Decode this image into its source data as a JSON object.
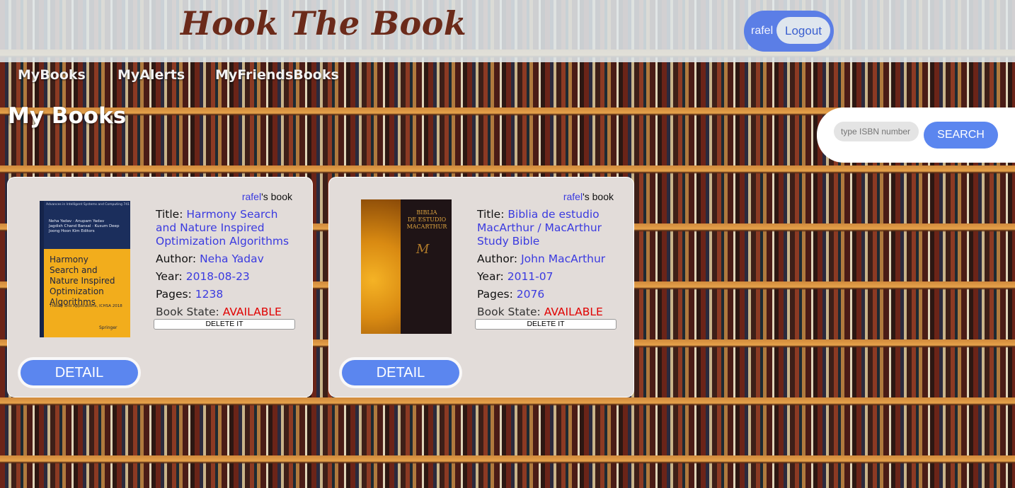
{
  "site": {
    "title": "Hook The Book"
  },
  "user": {
    "name": "rafel",
    "logout_label": "Logout"
  },
  "nav": {
    "items": [
      {
        "label": "MyBooks"
      },
      {
        "label": "MyAlerts"
      },
      {
        "label": "MyFriendsBooks"
      }
    ]
  },
  "page": {
    "title": "My Books"
  },
  "search": {
    "placeholder": "type ISBN number",
    "button_label": "SEARCH"
  },
  "books": [
    {
      "owner": "rafel",
      "owner_suffix": "'s book",
      "title_label": "Title:",
      "title": "Harmony Search and Nature Inspired Optimization Algorithms",
      "author_label": "Author:",
      "author": "Neha Yadav",
      "year_label": "Year:",
      "year": "2018-08-23",
      "pages_label": "Pages:",
      "pages": "1238",
      "state_label": "Book State:",
      "state": "AVAILABLE",
      "delete_label": "DELETE IT",
      "detail_label": "DETAIL",
      "cover": {
        "series": "Advances in Intelligent Systems and Computing  741",
        "editors_line1": "Neha Yadav · Anupam Yadav",
        "editors_line2": "Jagdish Chand Bansal · Kusum Deep",
        "editors_line3": "Joong Hoon Kim  Editors",
        "title_line1": "Harmony",
        "title_line2": "Search and",
        "title_line3": "Nature Inspired",
        "title_line4": "Optimization",
        "title_line5": "Algorithms",
        "subtitle": "Theory and Applications, ICHSA 2018",
        "publisher": "Springer"
      }
    },
    {
      "owner": "rafel",
      "owner_suffix": "'s book",
      "title_label": "Title:",
      "title": "Biblia de estudio MacArthur / MacArthur Study Bible",
      "author_label": "Author:",
      "author": "John MacArthur",
      "year_label": "Year:",
      "year": "2011-07",
      "pages_label": "Pages:",
      "pages": "2076",
      "state_label": "Book State:",
      "state": "AVAILABLE",
      "delete_label": "DELETE IT",
      "detail_label": "DETAIL",
      "cover": {
        "title_line1": "BIBLIA",
        "title_line2": "DE ESTUDIO",
        "title_line3": "MACARTHUR",
        "monogram": "M"
      }
    }
  ],
  "colors": {
    "accent": "#5b86ef",
    "link": "#3a3ae0",
    "available": "#e00000",
    "title": "#6b2a1a"
  }
}
